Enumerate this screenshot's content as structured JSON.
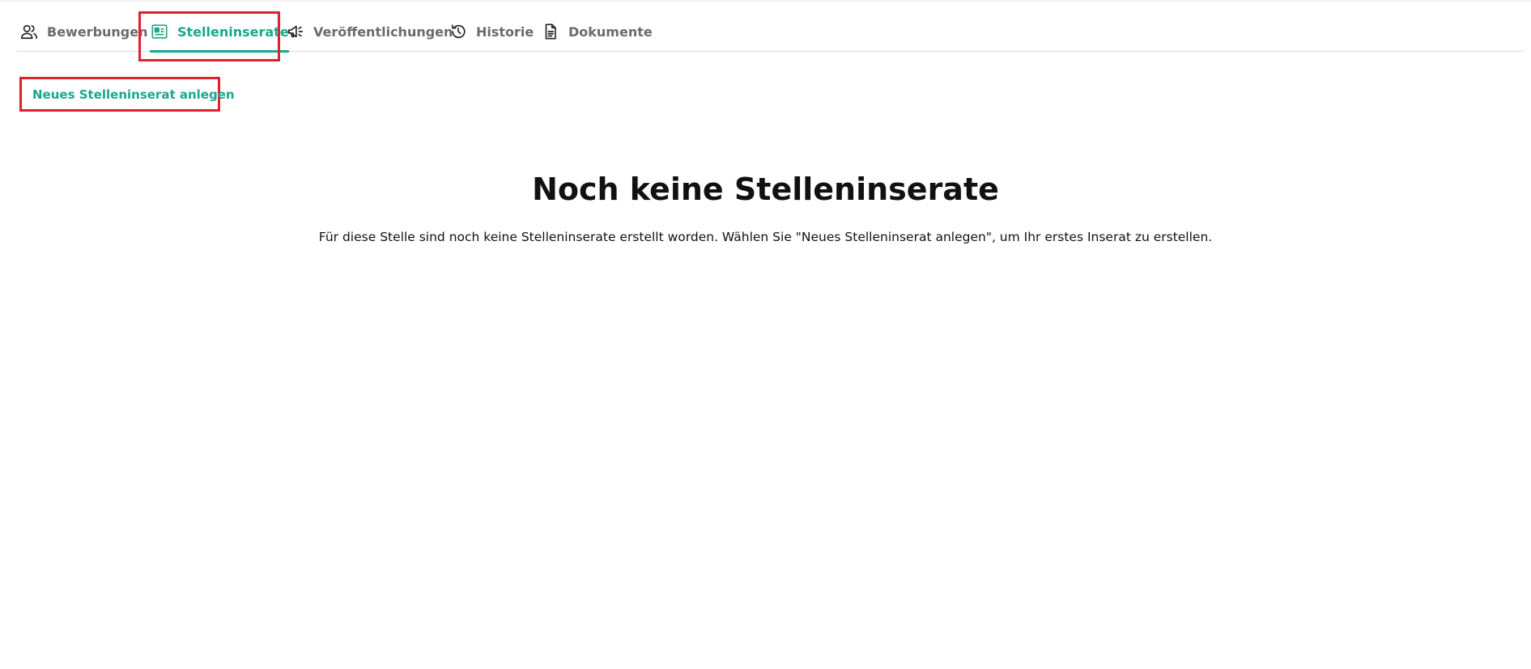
{
  "tabs": [
    {
      "label": "Bewerbungen",
      "icon": "users-icon",
      "active": false
    },
    {
      "label": "Stelleninserate",
      "icon": "id-card-icon",
      "active": true
    },
    {
      "label": "Veröffentlichungen",
      "icon": "megaphone-icon",
      "active": false
    },
    {
      "label": "Historie",
      "icon": "history-icon",
      "active": false
    },
    {
      "label": "Dokumente",
      "icon": "document-icon",
      "active": false
    }
  ],
  "actions": {
    "new_ad_label": "Neues Stelleninserat anlegen"
  },
  "empty_state": {
    "title": "Noch keine Stelleninserate",
    "text": "Für diese Stelle sind noch keine Stelleninserate erstellt worden. Wählen Sie \"Neues Stelleninserat anlegen\", um Ihr erstes Inserat zu erstellen."
  },
  "colors": {
    "accent": "#1aa88a",
    "highlight": "#e0202a",
    "tab_inactive": "#6b6b6b"
  }
}
